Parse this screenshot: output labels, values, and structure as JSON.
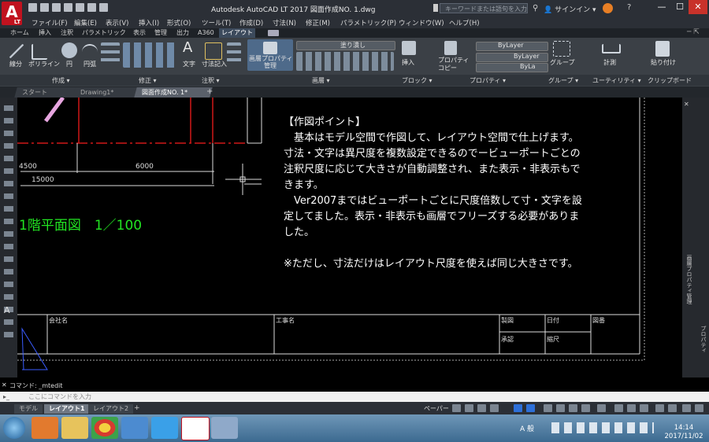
{
  "window": {
    "title": "Autodesk AutoCAD LT 2017   図面作成NO. 1.dwg",
    "logo_text": "A",
    "logo_sub": "LT",
    "search_placeholder": "キーワードまたは語句を入力",
    "signin": "サインイン",
    "min": "—",
    "max": "☐",
    "close": "✕"
  },
  "menu": [
    "ファイル(F)",
    "編集(E)",
    "表示(V)",
    "挿入(I)",
    "形式(O)",
    "ツール(T)",
    "作成(D)",
    "寸法(N)",
    "修正(M)",
    "パラメトリック(P)",
    "ウィンドウ(W)",
    "ヘルプ(H)"
  ],
  "ribbon_tabs": [
    "ホーム",
    "挿入",
    "注釈",
    "パラメトリック",
    "表示",
    "管理",
    "出力",
    "A360",
    "レイアウト"
  ],
  "ribbon": {
    "labels": {
      "line": "線分",
      "polyline": "ポリライン",
      "circle": "円",
      "arc": "円弧",
      "text": "文字",
      "dimension": "寸法記入",
      "match_layer": "画層プロパティ\n管理",
      "insert": "挿入",
      "match_prop": "プロパティ\nコピー",
      "group": "グループ",
      "measure": "計測",
      "paste": "貼り付け"
    },
    "layer_state": "塗り潰し",
    "bylayer_color": "ByLayer",
    "bylayer_linetype": "ByLayer",
    "bylayer_lineweight": "ByLa",
    "panels": [
      "作成 ▾",
      "修正 ▾",
      "注釈 ▾",
      "画層 ▾",
      "ブロック ▾",
      "プロパティ ▾",
      "グループ ▾",
      "ユーティリティ ▾",
      "クリップボード"
    ]
  },
  "doc_tabs": [
    "スタート",
    "Drawing1*",
    "図面作成NO. 1*"
  ],
  "drawing": {
    "notes": "【作図ポイント】\n　基本はモデル空間で作図して、レイアウト空間で仕上げます。寸法・文字は異尺度を複数設定できるのでービューポートごとの注釈尺度に応じて大きさが自動調整され、また表示・非表示もできます。\n　Ver2007まではビューポートごとに尺度倍数して寸・文字を設定してました。表示・非表示も画層でフリーズする必要がありました。\n\n※ただし、寸法だけはレイアウト尺度を使えば同じ大きさです。",
    "plan_title": "1階平面図　1／100",
    "dim_4500": "4500",
    "dim_6000": "6000",
    "dim_15000": "15000",
    "titleblock": {
      "company": "会社名",
      "project": "工事名",
      "drawn": "製図",
      "date": "日付",
      "drawing_no": "図番",
      "approved": "承認",
      "scale": "縮尺"
    }
  },
  "right_palette_labels": [
    "画層プロパティ管理",
    "プロパティ"
  ],
  "command": {
    "history": "コマンド:  _mtedit",
    "placeholder": "ここにコマンドを入力"
  },
  "layout_tabs": [
    "モデル",
    "レイアウト1",
    "レイアウト2"
  ],
  "status_paper": "ペーパー",
  "clock": {
    "time": "14:14",
    "date": "2017/11/02"
  },
  "tray_text": "A 般"
}
